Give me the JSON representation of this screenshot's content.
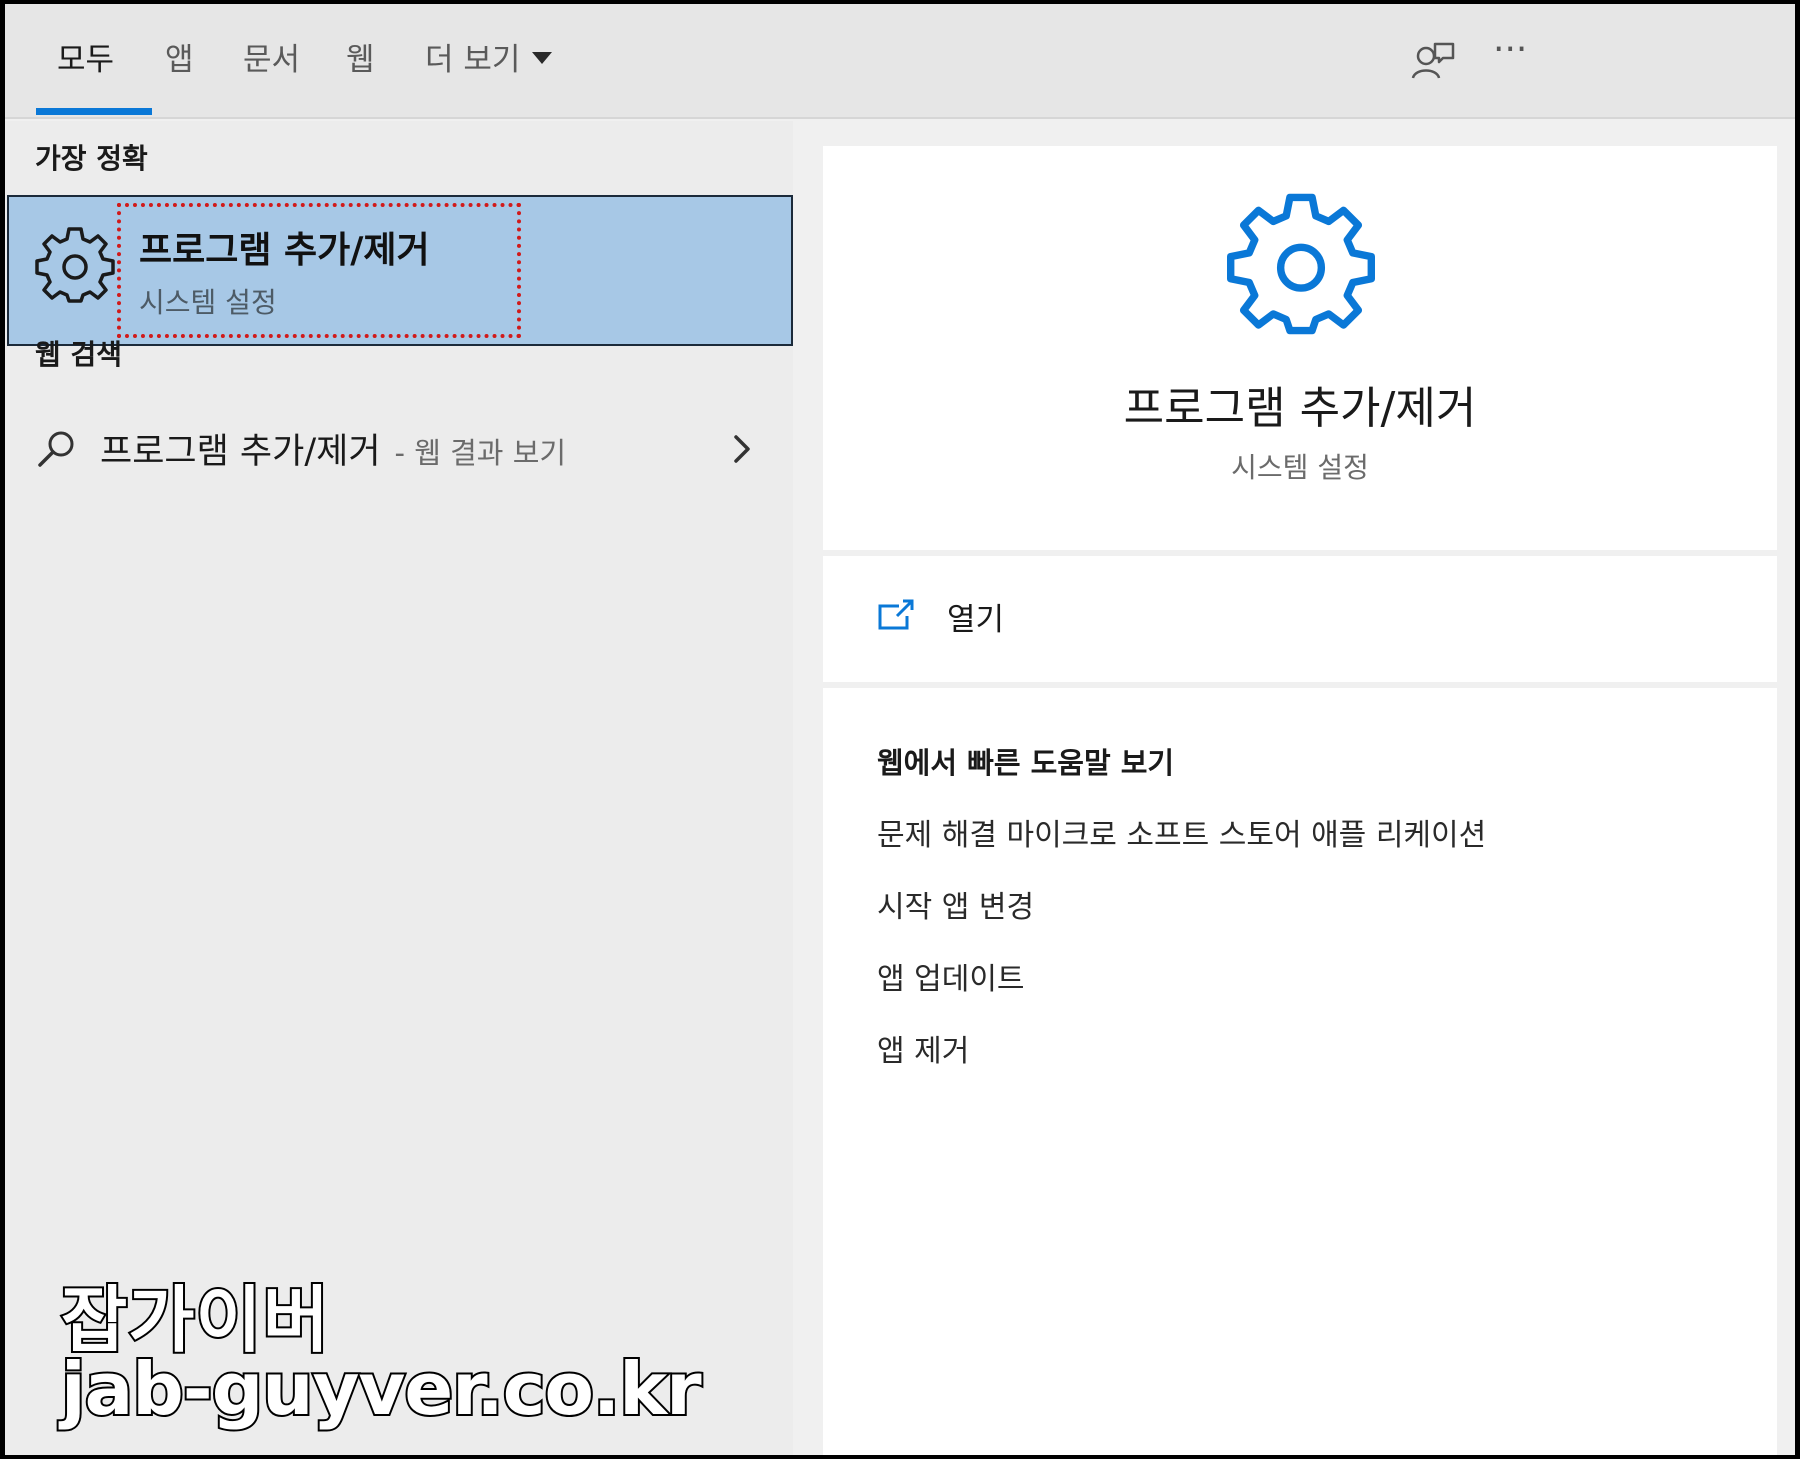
{
  "tabs": [
    {
      "label": "모두",
      "active": true
    },
    {
      "label": "앱",
      "active": false
    },
    {
      "label": "문서",
      "active": false
    },
    {
      "label": "웹",
      "active": false
    },
    {
      "label": "더 보기",
      "active": false
    }
  ],
  "toolbar": {
    "feedback_icon": "feedback-person-icon",
    "more_icon": "more-options-icon",
    "more_label": "···"
  },
  "left": {
    "best_match_heading": "가장 정확",
    "best_match": {
      "title": "프로그램 추가/제거",
      "subtitle": "시스템 설정",
      "icon": "gear-icon"
    },
    "web_search_heading": "웹 검색",
    "web_result": {
      "query": "프로그램 추가/제거",
      "suffix": "- 웹 결과 보기"
    }
  },
  "watermark": {
    "line1": "잡가이버",
    "line2": "jab-guyver.co.kr"
  },
  "right": {
    "title": "프로그램 추가/제거",
    "subtitle": "시스템 설정",
    "open_label": "열기",
    "help_heading": "웹에서 빠른 도움말 보기",
    "help_links": [
      "문제 해결 마이크로 소프트 스토어 애플 리케이션",
      "시작 앱 변경",
      "앱 업데이트",
      "앱 제거"
    ]
  },
  "colors": {
    "accent": "#0a78d7",
    "selected_bg": "#a7c8e6",
    "highlight_box": "#d11a1a"
  }
}
